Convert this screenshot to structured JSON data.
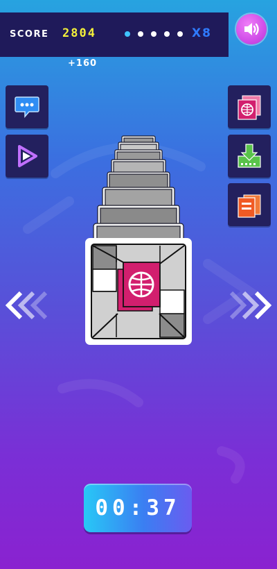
{
  "hud": {
    "score_label": "SCORE",
    "score_value": "2804",
    "combo_dots_total": 5,
    "combo_dots_active": 1,
    "multiplier": "X8",
    "bonus": "+160"
  },
  "timer": {
    "value": "00:37"
  },
  "side_buttons": {
    "left": [
      "chat-icon",
      "play-video-icon"
    ],
    "right": [
      "globe-card-icon",
      "download-icon",
      "cards-icon"
    ]
  },
  "colors": {
    "hud_bg": "#1f1a5a",
    "score": "#f3f03a",
    "multiplier": "#2f7bff",
    "card_magenta": "#d21f6e",
    "button_bg": "#23205e"
  }
}
